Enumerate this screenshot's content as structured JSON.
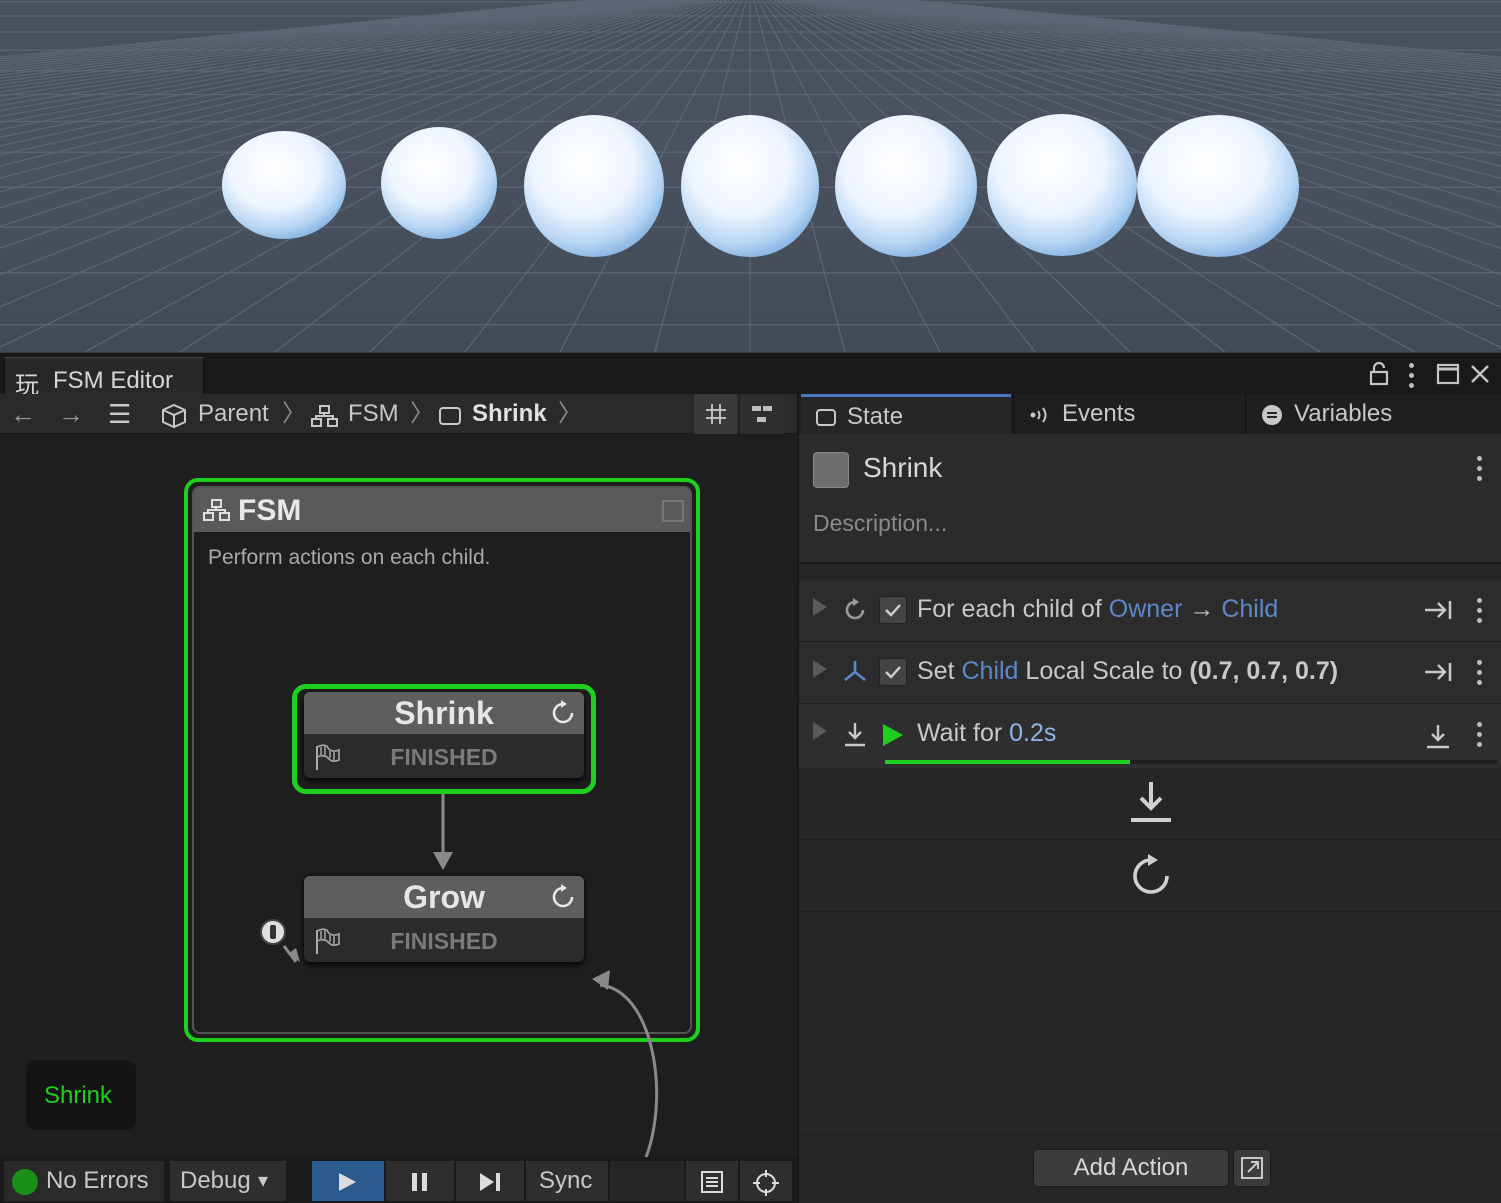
{
  "window": {
    "title": "FSM Editor",
    "title_icon": "玩"
  },
  "nav": {
    "back_icon": "←",
    "forward_icon": "→",
    "menu_icon": "☰",
    "breadcrumbs": [
      {
        "label": "Parent"
      },
      {
        "label": "FSM"
      },
      {
        "label": "Shrink"
      }
    ],
    "sep": "〉"
  },
  "graph": {
    "group_title": "FSM",
    "group_description": "Perform actions on each child.",
    "start_marker": "①",
    "states": [
      {
        "name": "Shrink",
        "event": "FINISHED",
        "active": true
      },
      {
        "name": "Grow",
        "event": "FINISHED",
        "active": false
      }
    ],
    "active_state_label": "Shrink"
  },
  "statusbar": {
    "errors": "No Errors",
    "debug": "Debug",
    "sync": "Sync",
    "debug_caret": "▾"
  },
  "inspector": {
    "tabs": [
      {
        "label": "State"
      },
      {
        "label": "Events"
      },
      {
        "label": "Variables"
      }
    ],
    "state_name": "Shrink",
    "description_placeholder": "Description...",
    "actions": [
      {
        "pre": "For each child of ",
        "ref1": "Owner",
        "mid": " → ",
        "ref2": "Child"
      },
      {
        "pre": "Set ",
        "ref1": "Child",
        "mid": " Local Scale to ",
        "val": "(0.7, 0.7, 0.7)"
      },
      {
        "pre": "Wait for ",
        "val": "0.2s"
      }
    ],
    "wait_progress": 0.4,
    "add_action": "Add Action"
  },
  "colors": {
    "accent_green": "#1fcf1f",
    "ref_blue": "#5d88c8",
    "value_blue": "#8fb4e6"
  }
}
